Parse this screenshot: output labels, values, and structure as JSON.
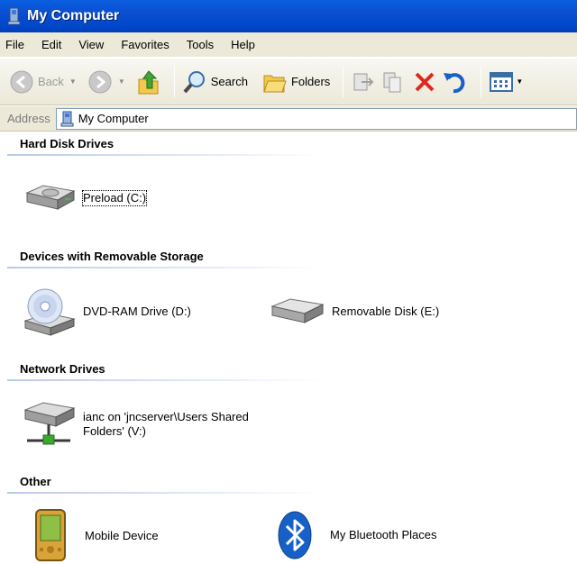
{
  "window": {
    "title": "My Computer"
  },
  "menu": [
    "File",
    "Edit",
    "View",
    "Favorites",
    "Tools",
    "Help"
  ],
  "toolbar": {
    "back_label": "Back",
    "search_label": "Search",
    "folders_label": "Folders"
  },
  "address": {
    "label": "Address",
    "value": "My Computer"
  },
  "groups": {
    "hard_disks": {
      "title": "Hard Disk Drives",
      "items": [
        {
          "label": "Preload (C:)"
        }
      ]
    },
    "removable": {
      "title": "Devices with Removable Storage",
      "items": [
        {
          "label": "DVD-RAM Drive (D:)"
        },
        {
          "label": "Removable Disk (E:)"
        }
      ]
    },
    "network": {
      "title": "Network Drives",
      "items": [
        {
          "label_line1": "ianc on 'jncserver\\Users Shared",
          "label_line2": "Folders' (V:)"
        }
      ]
    },
    "other": {
      "title": "Other",
      "items": [
        {
          "label": "Mobile Device"
        },
        {
          "label": "My Bluetooth Places"
        }
      ]
    }
  },
  "colors": {
    "titlebar": "#0a4fd0",
    "chrome": "#ece9d8",
    "delete_x": "#e0281c",
    "bluetooth": "#1660c8"
  }
}
